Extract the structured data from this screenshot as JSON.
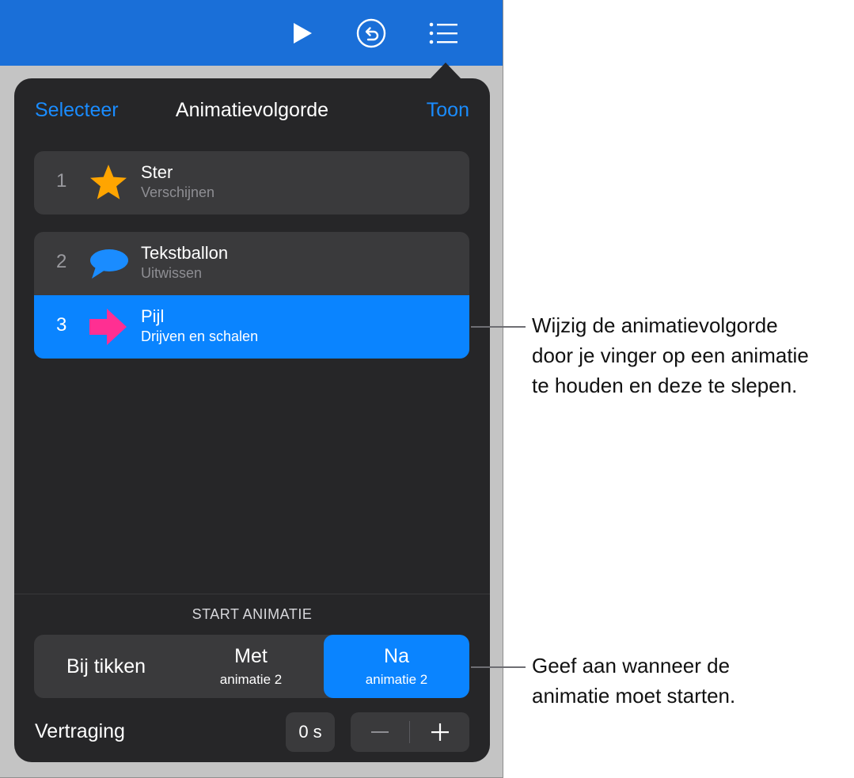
{
  "header": {
    "select_label": "Selecteer",
    "title": "Animatievolgorde",
    "show_label": "Toon"
  },
  "toolbar": {
    "icons": [
      "play-icon",
      "undo-icon",
      "list-icon"
    ]
  },
  "animations": [
    {
      "number": "1",
      "name": "Ster",
      "effect": "Verschijnen",
      "icon": "star-icon",
      "color": "#ffa500"
    },
    {
      "number": "2",
      "name": "Tekstballon",
      "effect": "Uitwissen",
      "icon": "speech-bubble-icon",
      "color": "#1a8cff"
    },
    {
      "number": "3",
      "name": "Pijl",
      "effect": "Drijven en schalen",
      "icon": "arrow-icon",
      "color": "#ff2f92",
      "selected": true
    }
  ],
  "start": {
    "section_title": "START ANIMATIE",
    "options": [
      {
        "label": "Bij tikken"
      },
      {
        "label": "Met",
        "sub": "animatie 2"
      },
      {
        "label": "Na",
        "sub": "animatie 2",
        "selected": true
      }
    ]
  },
  "delay": {
    "label": "Vertraging",
    "value": "0 s",
    "minus": "−",
    "plus": "+"
  },
  "callouts": [
    "Wijzig de animatievolgorde\ndoor je vinger op een animatie\nte houden en deze te slepen.",
    "Geef aan wanneer de\nanimatie moet starten."
  ],
  "colors": {
    "toolbar": "#1a6fd8",
    "accent": "#0a84ff",
    "panel": "#262628",
    "cell": "#3a3a3c"
  }
}
